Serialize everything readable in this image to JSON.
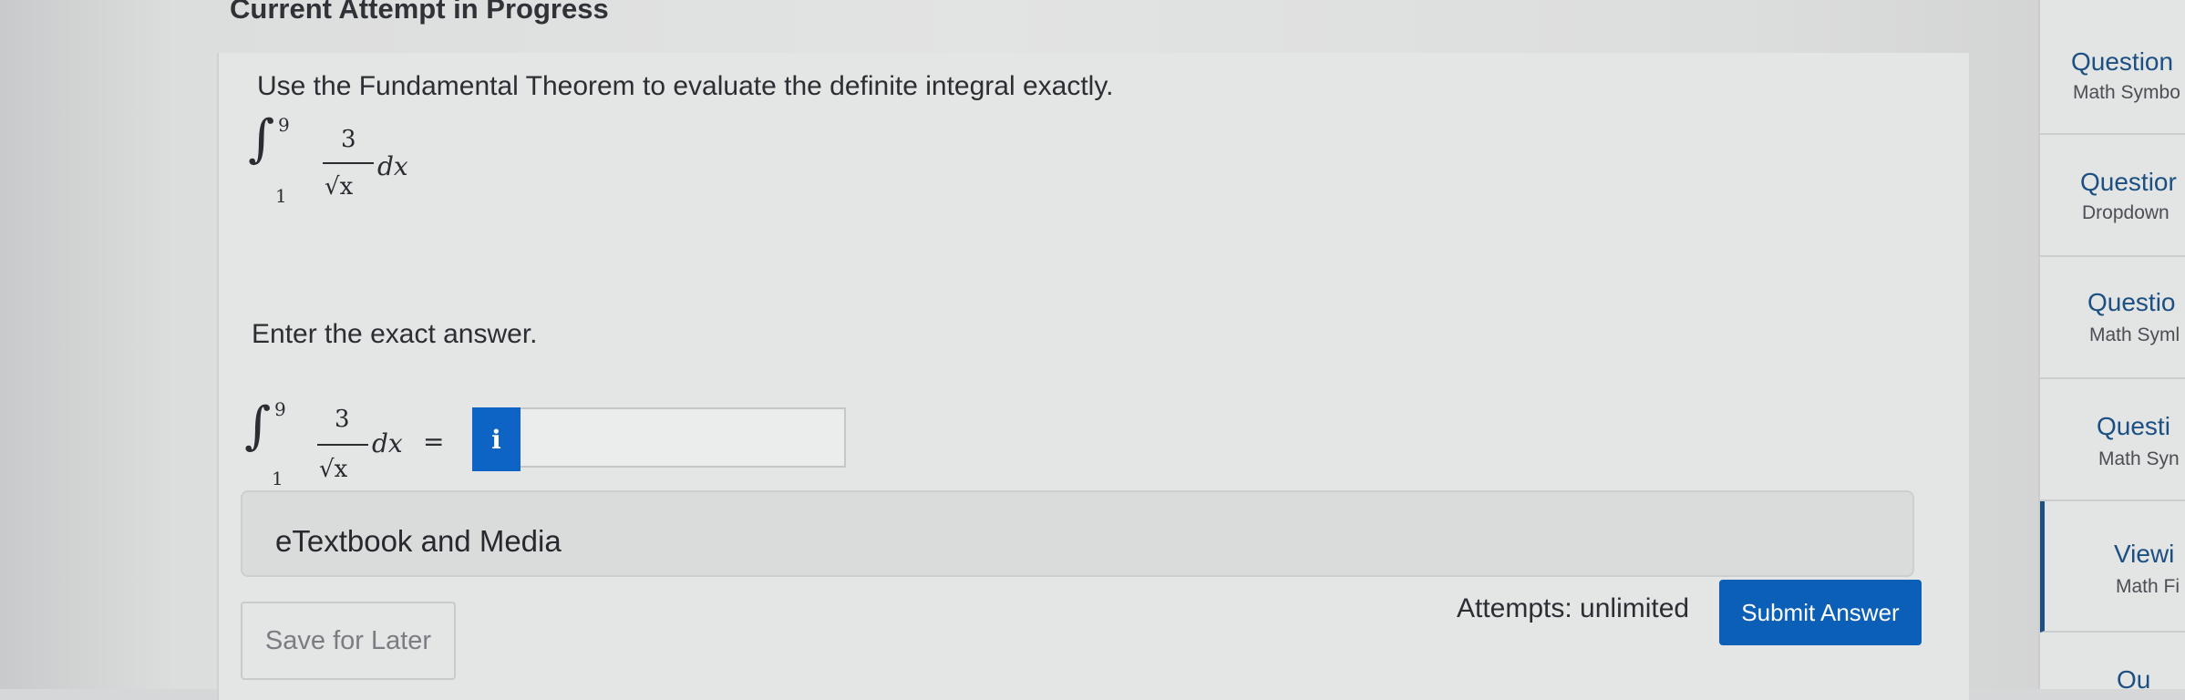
{
  "header": {
    "title": "Current Attempt in Progress"
  },
  "question": {
    "prompt": "Use the Fundamental Theorem to evaluate the definite integral exactly.",
    "integral": {
      "lower": "1",
      "upper": "9",
      "numerator": "3",
      "denominator": "√x",
      "differential": "dx"
    },
    "enter_label": "Enter the exact answer.",
    "equals": "=",
    "info_icon": "i",
    "answer_value": ""
  },
  "resources": {
    "label": "eTextbook and Media"
  },
  "footer": {
    "save_label": "Save for Later",
    "attempts_label": "Attempts: unlimited",
    "submit_label": "Submit Answer"
  },
  "sidebar": {
    "items": [
      {
        "title": "Question",
        "subtitle": "Math Symbo"
      },
      {
        "title": "Questior",
        "subtitle": "Dropdown"
      },
      {
        "title": "Questio",
        "subtitle": "Math Syml"
      },
      {
        "title": "Questi",
        "subtitle": "Math Syn"
      },
      {
        "title": "Viewi",
        "subtitle": "Math Fi"
      },
      {
        "title": "Ou",
        "subtitle": ""
      }
    ]
  },
  "colors": {
    "accent": "#0b5fb7",
    "info": "#0d64c4",
    "sidebar_text": "#1c4f82"
  }
}
